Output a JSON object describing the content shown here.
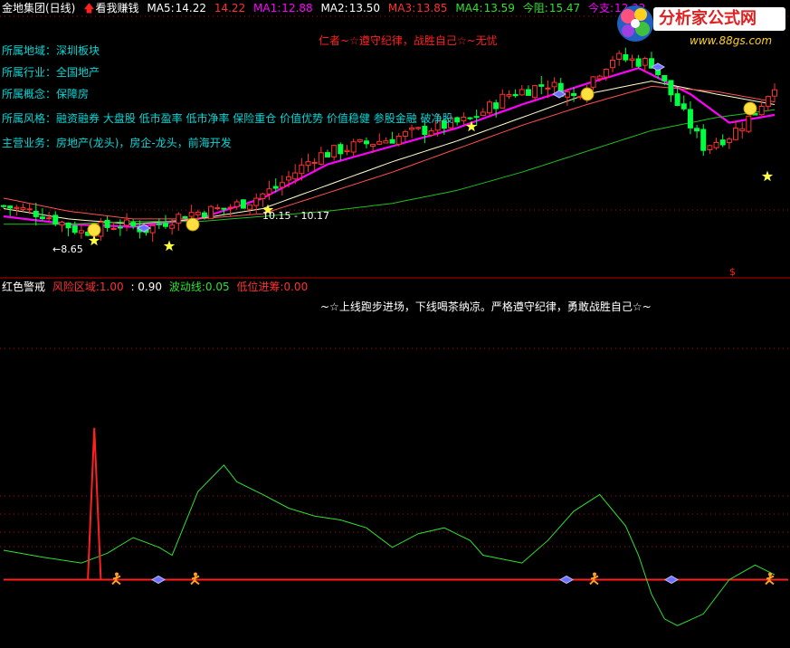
{
  "header": {
    "stock": "金地集团(日线)",
    "signal_name": "看我赚钱",
    "ma5_label": "MA5:",
    "ma5_value": "14.22",
    "ma5_extra": "14.22",
    "ma1_label": "MA1:",
    "ma1_value": "12.88",
    "ma2_label": "MA2:",
    "ma2_value": "13.50",
    "ma3_label": "MA3:",
    "ma3_value": "13.85",
    "ma4_label": "MA4:",
    "ma4_value": "13.59",
    "resist_label": "今阻:",
    "resist_value": "15.47",
    "support_label": "今支:",
    "support_value": "12.32"
  },
  "info": [
    {
      "key": "所属地域：",
      "value": "深圳板块"
    },
    {
      "key": "所属行业：",
      "value": "全国地产"
    },
    {
      "key": "所属概念：",
      "value": "保障房"
    },
    {
      "key": "所属风格：",
      "value": "融资融券 大盘股 低市盈率 低市净率 保险重仓 价值优势 价值稳健 参股金融 破净股"
    },
    {
      "key": "主营业务：",
      "value": "房地产(龙头)，房企-龙头，前海开发"
    }
  ],
  "slogan_top": "仁者~☆遵守纪律，战胜自己☆~无忧",
  "low_label": "←8.65",
  "range_label": "10.15 - 10.17",
  "indicator": {
    "name": "红色警戒",
    "risk_label": "风险区域:",
    "risk_value": "1.00",
    "extra_value": ": 0.90",
    "wave_label": "波动线:",
    "wave_value": "0.05",
    "low_label": "低位进筹:",
    "low_value": "0.00"
  },
  "slogan_bottom": "~☆上线跑步进场，下线喝茶纳凉。严格遵守纪律，勇敢战胜自己☆~",
  "logo": {
    "title": "分析家公式网",
    "url": "www.88gs.com"
  },
  "dollar_marker": "$",
  "colors": {
    "up": "#ff3030",
    "down": "#00ff40",
    "ma_pink": "#ff00ff",
    "ma_white": "#ffffcc",
    "ma_red": "#ff5050",
    "ma_green": "#20c020",
    "wave": "#30e030",
    "risk": "#ff2020",
    "grid": "#c00000"
  },
  "chart_data": [
    {
      "type": "candlestick",
      "title": "金地集团(日线)",
      "n_bars": 120,
      "price_range": [
        8.65,
        16.2
      ],
      "low_marked": 8.65,
      "anchor_closes": [
        [
          0,
          10.3
        ],
        [
          6,
          10.0
        ],
        [
          12,
          9.3
        ],
        [
          18,
          9.6
        ],
        [
          22,
          9.4
        ],
        [
          28,
          10.0
        ],
        [
          34,
          10.2
        ],
        [
          38,
          10.5
        ],
        [
          42,
          11.0
        ],
        [
          48,
          12.2
        ],
        [
          54,
          12.6
        ],
        [
          60,
          12.9
        ],
        [
          66,
          13.3
        ],
        [
          72,
          13.6
        ],
        [
          78,
          14.6
        ],
        [
          84,
          15.0
        ],
        [
          88,
          14.5
        ],
        [
          94,
          16.0
        ],
        [
          100,
          15.8
        ],
        [
          104,
          14.2
        ],
        [
          108,
          12.6
        ],
        [
          112,
          13.0
        ],
        [
          116,
          13.9
        ],
        [
          119,
          15.0
        ]
      ],
      "ma_lines": [
        {
          "name": "MA1",
          "color": "#ff00ff",
          "anchors": [
            [
              0,
              9.9
            ],
            [
              10,
              9.6
            ],
            [
              20,
              9.5
            ],
            [
              30,
              9.8
            ],
            [
              40,
              10.6
            ],
            [
              50,
              11.9
            ],
            [
              60,
              12.6
            ],
            [
              70,
              13.3
            ],
            [
              80,
              14.2
            ],
            [
              90,
              15.0
            ],
            [
              98,
              15.6
            ],
            [
              106,
              14.6
            ],
            [
              112,
              13.5
            ],
            [
              119,
              13.8
            ]
          ]
        },
        {
          "name": "MA2",
          "color": "#ffffcc",
          "anchors": [
            [
              0,
              10.2
            ],
            [
              10,
              9.8
            ],
            [
              20,
              9.6
            ],
            [
              30,
              9.8
            ],
            [
              40,
              10.2
            ],
            [
              50,
              11.1
            ],
            [
              60,
              12.0
            ],
            [
              70,
              12.8
            ],
            [
              80,
              13.7
            ],
            [
              90,
              14.6
            ],
            [
              100,
              15.1
            ],
            [
              110,
              14.6
            ],
            [
              119,
              14.2
            ]
          ]
        },
        {
          "name": "MA3",
          "color": "#ff5050",
          "anchors": [
            [
              0,
              10.6
            ],
            [
              10,
              10.1
            ],
            [
              20,
              9.8
            ],
            [
              30,
              9.8
            ],
            [
              40,
              10.0
            ],
            [
              50,
              10.8
            ],
            [
              60,
              11.6
            ],
            [
              70,
              12.5
            ],
            [
              80,
              13.4
            ],
            [
              90,
              14.2
            ],
            [
              100,
              14.9
            ],
            [
              110,
              14.7
            ],
            [
              119,
              14.3
            ]
          ]
        },
        {
          "name": "MA4",
          "color": "#20c020",
          "anchors": [
            [
              0,
              9.6
            ],
            [
              10,
              9.6
            ],
            [
              20,
              9.7
            ],
            [
              30,
              9.7
            ],
            [
              40,
              9.9
            ],
            [
              50,
              10.1
            ],
            [
              60,
              10.4
            ],
            [
              70,
              10.9
            ],
            [
              80,
              11.6
            ],
            [
              90,
              12.4
            ],
            [
              100,
              13.2
            ],
            [
              110,
              13.7
            ],
            [
              119,
              14.0
            ]
          ]
        }
      ]
    },
    {
      "type": "line",
      "title": "红色警戒",
      "series": [
        {
          "name": "波动线",
          "color": "#30e030",
          "x": [
            0,
            6,
            12,
            16,
            20,
            24,
            26,
            30,
            34,
            36,
            40,
            44,
            48,
            52,
            56,
            60,
            64,
            68,
            72,
            74,
            80,
            84,
            88,
            92,
            96,
            98,
            100,
            102,
            104,
            108,
            112,
            116,
            119
          ],
          "values": [
            0.35,
            0.28,
            0.22,
            0.32,
            0.48,
            0.38,
            0.3,
            0.95,
            1.22,
            1.05,
            0.92,
            0.78,
            0.7,
            0.66,
            0.58,
            0.38,
            0.52,
            0.58,
            0.45,
            0.3,
            0.22,
            0.45,
            0.75,
            0.92,
            0.6,
            0.3,
            -0.1,
            -0.35,
            -0.42,
            -0.3,
            0.05,
            0.2,
            0.1
          ]
        },
        {
          "name": "风险区域",
          "color": "#ff2020",
          "x": [
            13,
            14,
            15
          ],
          "values": [
            0.05,
            1.6,
            0.05
          ]
        }
      ],
      "ylim": [
        -0.5,
        1.7
      ],
      "baseline": 0.05
    }
  ]
}
